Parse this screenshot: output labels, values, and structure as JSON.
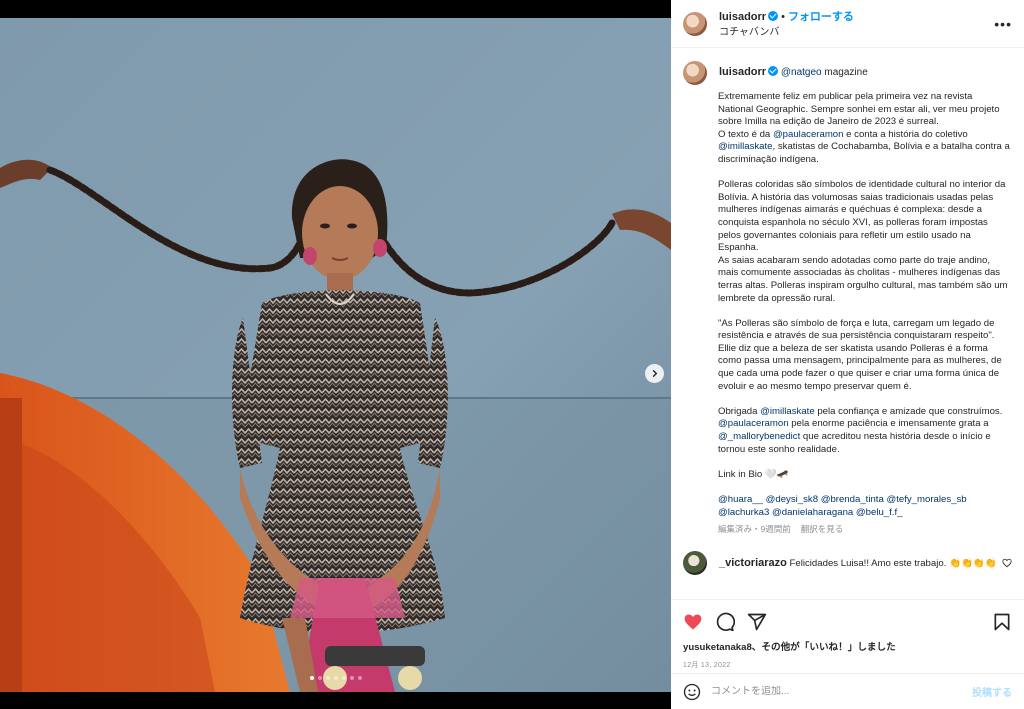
{
  "header": {
    "username": "luisadorr",
    "separator": "•",
    "follow_label": "フォローする",
    "location": "コチャバンバ",
    "more_label": "•••"
  },
  "caption": {
    "author": "luisadorr",
    "tag": "@natgeo",
    "tag_suffix": "magazine",
    "paragraphs": [
      "Extremamente feliz em publicar pela primeira vez na revista National Geographic. Sempre sonhei em estar ali, ver meu projeto sobre Imilla na edição de Janeiro de 2023 é surreal.\nO texto é da @paulaceramon e conta a história do coletivo @imillaskate, skatistas de Cochabamba, Bolívia e a batalha contra a discriminação indígena.",
      "Polleras coloridas são símbolos de identidade cultural no interior da Bolívia. A história das volumosas saias tradicionais usadas pelas mulheres indígenas aimarás e quéchuas é complexa: desde a conquista espanhola no século XVI, as polleras foram impostas pelos governantes coloniais para refletir um estilo usado na Espanha.\nAs saias acabaram sendo adotadas como parte do traje andino, mais comumente associadas às cholitas - mulheres indígenas das terras altas. Polleras inspiram orgulho cultural, mas também são um lembrete da opressão rural.",
      "\"As Polleras são símbolo de força e luta, carregam um legado de resistência e através de sua persistência conquistaram respeito\". Ellie diz que a beleza de ser skatista usando Polleras é a forma como passa uma mensagem, principalmente para as mulheres, de que cada uma pode fazer o que quiser e criar uma forma única de evoluir e ao mesmo tempo preservar quem é.",
      "Obrigada @imillaskate pela confiança e amizade que construímos.\n@paulaceramon pela enorme paciência e imensamente grata a @_mallorybenedict que acreditou nesta história desde o início e tornou este sonho realidade.",
      "Link in Bio 🤍🛹",
      "@huara__ @deysi_sk8 @brenda_tinta @tefy_morales_sb @lachurka3 @danielaharagana @belu_f.f_"
    ],
    "meta_edited": "編集済み・9週間前",
    "meta_translate": "翻訳を見る"
  },
  "comment": {
    "username": "_victoriarazo",
    "text": "Felicidades Luisa!! Amo este trabajo. 👏👏👏👏"
  },
  "actions": {
    "liked_by_user": "yusuketanaka8",
    "liked_by_rest": "、その他が「いいね！」しました",
    "date": "12月 13, 2022"
  },
  "composer": {
    "placeholder": "コメントを追加...",
    "post_label": "投稿する"
  },
  "carousel": {
    "slide_count": 7,
    "active_index": 0
  },
  "colors": {
    "link": "#00376b",
    "accent_blue": "#0095f6",
    "like_red": "#ed4956",
    "muted": "#8e8e8e"
  }
}
